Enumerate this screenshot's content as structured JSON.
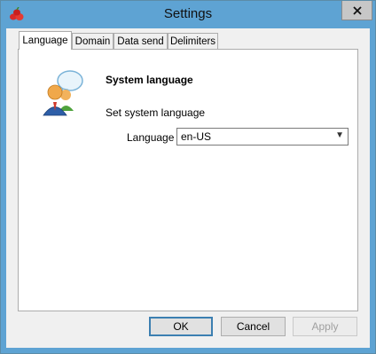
{
  "window": {
    "title": "Settings"
  },
  "tabs": [
    {
      "label": "Language",
      "active": true
    },
    {
      "label": "Domain"
    },
    {
      "label": "Data send"
    },
    {
      "label": "Delimiters"
    }
  ],
  "language_page": {
    "heading": "System language",
    "description": "Set system language",
    "field_label": "Language",
    "selected_value": "en-US"
  },
  "buttons": {
    "ok": "OK",
    "cancel": "Cancel",
    "apply": "Apply"
  },
  "icons": {
    "app": "red-cube-icon",
    "close": "close-icon",
    "language": "people-speech-bubble-icon",
    "dropdown": "chevron-down-icon"
  }
}
